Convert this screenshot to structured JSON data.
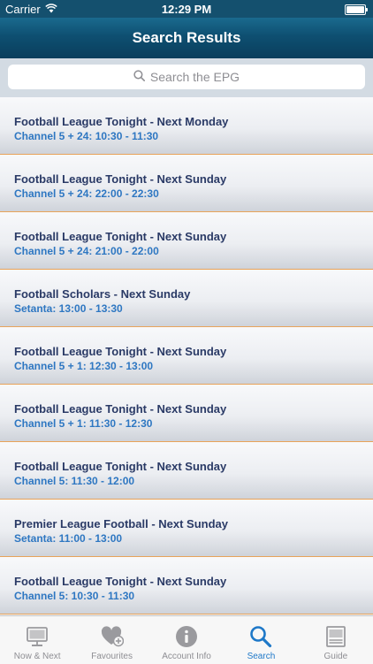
{
  "status_bar": {
    "carrier": "Carrier",
    "time": "12:29 PM"
  },
  "nav": {
    "title": "Search Results"
  },
  "search": {
    "placeholder": "Search the EPG",
    "icon": "search-icon"
  },
  "results": [
    {
      "title": "Football League Tonight  - Next Monday",
      "subtitle": "Channel 5 + 24: 10:30 - 11:30"
    },
    {
      "title": "Football League Tonight  - Next Sunday",
      "subtitle": "Channel 5 + 24: 22:00 - 22:30"
    },
    {
      "title": "Football League Tonight  - Next Sunday",
      "subtitle": "Channel 5 + 24: 21:00 - 22:00"
    },
    {
      "title": "Football Scholars  - Next Sunday",
      "subtitle": "Setanta: 13:00 - 13:30"
    },
    {
      "title": "Football League Tonight  - Next Sunday",
      "subtitle": "Channel 5 + 1: 12:30 - 13:00"
    },
    {
      "title": "Football League Tonight  - Next Sunday",
      "subtitle": "Channel 5 + 1: 11:30 - 12:30"
    },
    {
      "title": "Football League Tonight  - Next Sunday",
      "subtitle": "Channel 5: 11:30 - 12:00"
    },
    {
      "title": "Premier League Football  - Next Sunday",
      "subtitle": "Setanta: 11:00 - 13:00"
    },
    {
      "title": "Football League Tonight  - Next Sunday",
      "subtitle": "Channel 5: 10:30 - 11:30"
    }
  ],
  "tabs": [
    {
      "label": "Now & Next",
      "icon": "tv-icon",
      "active": false
    },
    {
      "label": "Favourites",
      "icon": "heart-plus-icon",
      "active": false
    },
    {
      "label": "Account Info",
      "icon": "info-icon",
      "active": false
    },
    {
      "label": "Search",
      "icon": "search-icon",
      "active": true
    },
    {
      "label": "Guide",
      "icon": "guide-icon",
      "active": false
    }
  ],
  "colors": {
    "nav_bar": "#0e4f71",
    "title_text": "#2a3a66",
    "subtitle_text": "#2e77c2",
    "tab_active": "#1e78c8",
    "tab_inactive": "#8e8e93",
    "row_separator": "#e8a35a"
  }
}
